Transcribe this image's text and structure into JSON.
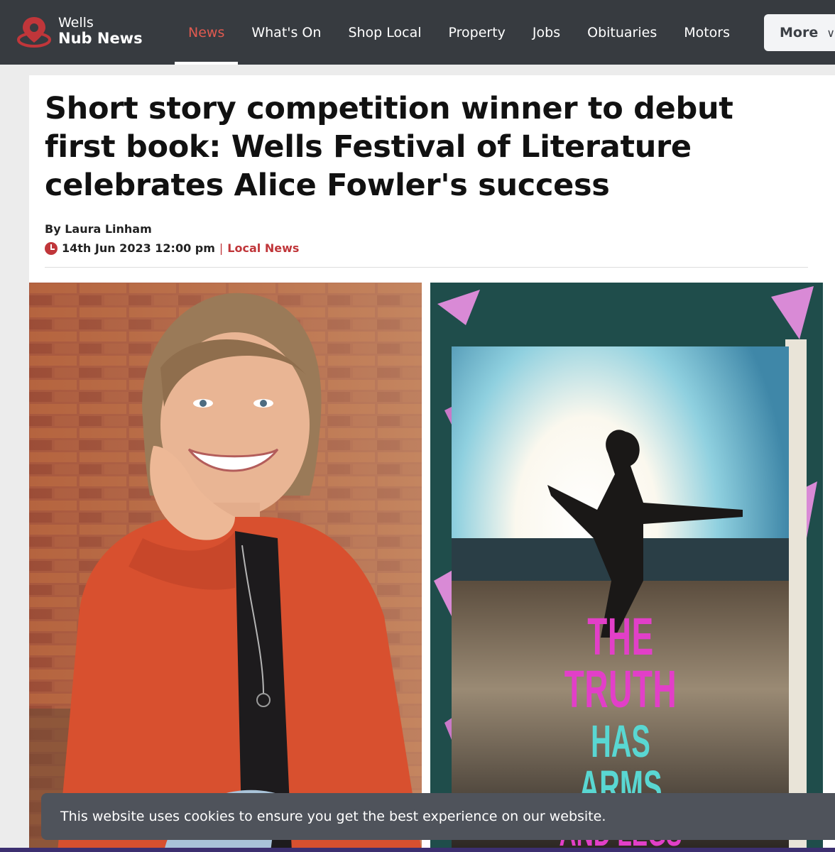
{
  "brand": {
    "line1": "Wells",
    "line2": "Nub News",
    "icon": "map-pin-icon",
    "accent": "#c0363a"
  },
  "nav": {
    "items": [
      {
        "label": "News",
        "active": true
      },
      {
        "label": "What's On"
      },
      {
        "label": "Shop Local"
      },
      {
        "label": "Property"
      },
      {
        "label": "Jobs"
      },
      {
        "label": "Obituaries"
      },
      {
        "label": "Motors"
      }
    ],
    "more_label": "More",
    "more_icon": "chevron-down-icon"
  },
  "article": {
    "headline": "Short story competition winner to debut first book: Wells Festival of Literature celebrates Alice Fowler's success",
    "byline": "By Laura Linham",
    "date": "14th Jun 2023 12:00 pm",
    "separator": "|",
    "category": "Local News"
  },
  "book_cover": {
    "title_line1": "THE TRUTH",
    "title_line2": "HAS ARMS",
    "title_line3": "AND LEGS"
  },
  "cookie_banner": {
    "text": "This website uses cookies to ensure you get the best experience on our website."
  },
  "colors": {
    "nav_bg": "#373b40",
    "active_nav": "#e05a50",
    "accent": "#c0363a",
    "cookie_bg": "#4f535b"
  }
}
